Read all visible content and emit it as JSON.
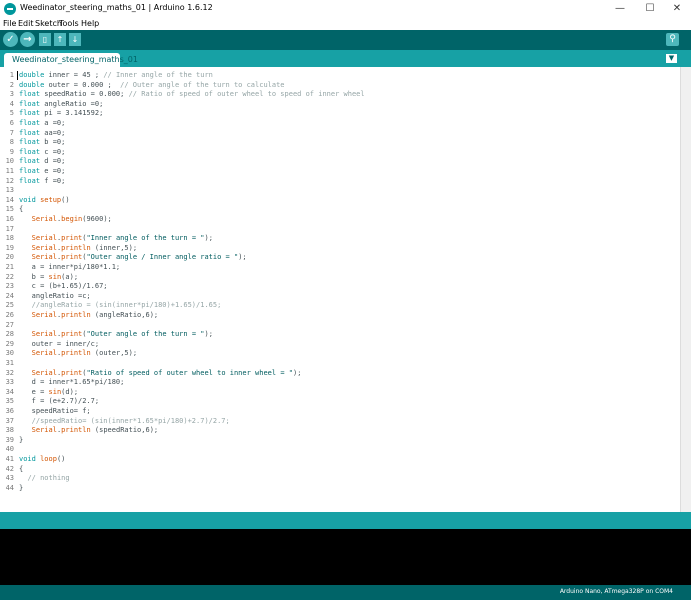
{
  "window": {
    "title": "Weedinator_steering_maths_01 | Arduino 1.6.12",
    "minimize": "—",
    "maximize": "☐",
    "close": "✕"
  },
  "menu": [
    "File",
    "Edit",
    "Sketch",
    "Tools",
    "Help"
  ],
  "toolbar": {
    "verify_icon": "check-icon",
    "upload_icon": "arrow-right-icon",
    "new_icon": "new-file-icon",
    "open_icon": "arrow-up-icon",
    "save_icon": "arrow-down-icon",
    "serial_icon": "magnifier-icon"
  },
  "tab": {
    "label": "Weedinator_steering_maths_01"
  },
  "code": [
    {
      "n": "1",
      "t": "double inner = 45 ; // Inner angle of the turn"
    },
    {
      "n": "2",
      "t": "double outer = 0.000 ;  // Outer angle of the turn to calculate"
    },
    {
      "n": "3",
      "t": "float speedRatio = 0.000; // Ratio of speed of outer wheel to speed of inner wheel"
    },
    {
      "n": "4",
      "t": "float angleRatio =0;"
    },
    {
      "n": "5",
      "t": "float pi = 3.141592;"
    },
    {
      "n": "6",
      "t": "float a =0;"
    },
    {
      "n": "7",
      "t": "float aa=0;"
    },
    {
      "n": "8",
      "t": "float b =0;"
    },
    {
      "n": "9",
      "t": "float c =0;"
    },
    {
      "n": "10",
      "t": "float d =0;"
    },
    {
      "n": "11",
      "t": "float e =0;"
    },
    {
      "n": "12",
      "t": "float f =0;"
    },
    {
      "n": "13",
      "t": ""
    },
    {
      "n": "14",
      "t": "void setup()"
    },
    {
      "n": "15",
      "t": "{"
    },
    {
      "n": "16",
      "t": "   Serial.begin(9600);"
    },
    {
      "n": "17",
      "t": ""
    },
    {
      "n": "18",
      "t": "   Serial.print(\"Inner angle of the turn = \");"
    },
    {
      "n": "19",
      "t": "   Serial.println (inner,5);"
    },
    {
      "n": "20",
      "t": "   Serial.print(\"Outer angle / Inner angle ratio = \");"
    },
    {
      "n": "21",
      "t": "   a = inner*pi/180*1.1;"
    },
    {
      "n": "22",
      "t": "   b = sin(a);"
    },
    {
      "n": "23",
      "t": "   c = (b+1.65)/1.67;"
    },
    {
      "n": "24",
      "t": "   angleRatio =c;"
    },
    {
      "n": "25",
      "t": "   //angleRatio = (sin(inner*pi/180)+1.65)/1.65;"
    },
    {
      "n": "26",
      "t": "   Serial.println (angleRatio,6);"
    },
    {
      "n": "27",
      "t": ""
    },
    {
      "n": "28",
      "t": "   Serial.print(\"Outer angle of the turn = \");"
    },
    {
      "n": "29",
      "t": "   outer = inner/c;"
    },
    {
      "n": "30",
      "t": "   Serial.println (outer,5);"
    },
    {
      "n": "31",
      "t": ""
    },
    {
      "n": "32",
      "t": "   Serial.print(\"Ratio of speed of outer wheel to inner wheel = \");"
    },
    {
      "n": "33",
      "t": "   d = inner*1.65*pi/180;"
    },
    {
      "n": "34",
      "t": "   e = sin(d);"
    },
    {
      "n": "35",
      "t": "   f = (e+2.7)/2.7;"
    },
    {
      "n": "36",
      "t": "   speedRatio= f;"
    },
    {
      "n": "37",
      "t": "   //speedRatio= (sin(inner*1.65*pi/180)+2.7)/2.7;"
    },
    {
      "n": "38",
      "t": "   Serial.println (speedRatio,6);"
    },
    {
      "n": "39",
      "t": "}"
    },
    {
      "n": "40",
      "t": ""
    },
    {
      "n": "41",
      "t": "void loop()"
    },
    {
      "n": "42",
      "t": "{"
    },
    {
      "n": "43",
      "t": "  // nothing"
    },
    {
      "n": "44",
      "t": "}"
    }
  ],
  "status": {
    "board": "Arduino Nano, ATmega328P on COM4"
  },
  "colors": {
    "teal_dark": "#006468",
    "teal": "#17a1a5",
    "keyword": "#00979c",
    "function": "#d35400",
    "comment": "#95a5a6",
    "string": "#005c5f",
    "text": "#434f54"
  }
}
